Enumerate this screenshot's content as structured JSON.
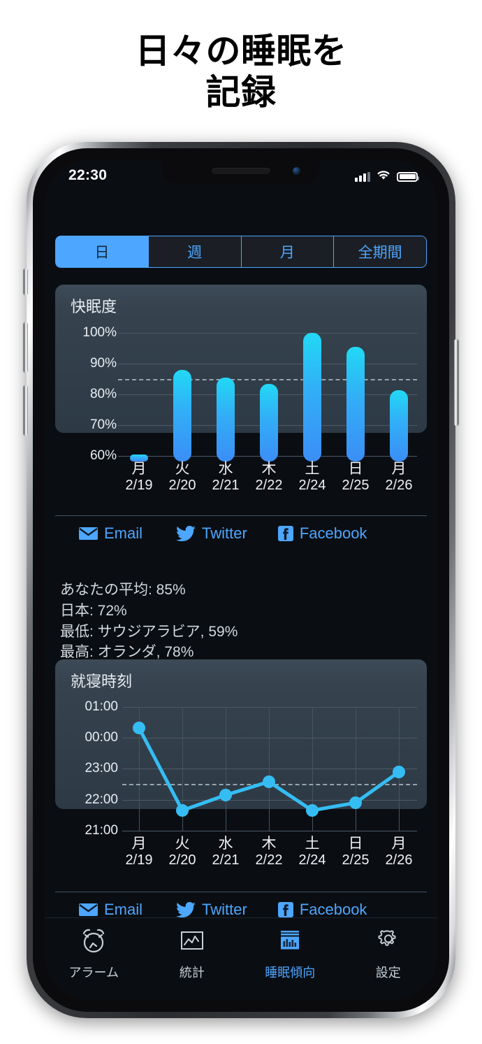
{
  "headline": "日々の睡眠を\n記録",
  "status_bar": {
    "time": "22:30",
    "cellular_icon": "cellular-bars-icon",
    "wifi_icon": "wifi-icon",
    "battery_icon": "battery-full-icon"
  },
  "segmented_control": {
    "selected": "日",
    "options": [
      "日",
      "週",
      "月",
      "全期間"
    ]
  },
  "sleep_quality_card": {
    "title": "快眠度",
    "share": [
      {
        "label": "Email",
        "icon": "email-icon"
      },
      {
        "label": "Twitter",
        "icon": "twitter-icon"
      },
      {
        "label": "Facebook",
        "icon": "facebook-icon"
      }
    ]
  },
  "bedtime_card": {
    "title": "就寝時刻",
    "share": [
      {
        "label": "Email",
        "icon": "email-icon"
      },
      {
        "label": "Twitter",
        "icon": "twitter-icon"
      },
      {
        "label": "Facebook",
        "icon": "facebook-icon"
      }
    ]
  },
  "stats": {
    "your_average": "あなたの平均: 85%",
    "country": "日本: 72%",
    "lowest": "最低: サウジアラビア, 59%",
    "highest": "最高: オランダ, 78%"
  },
  "tab_bar": {
    "active": "睡眠傾向",
    "items": [
      {
        "label": "アラーム",
        "icon": "alarm-clock-icon"
      },
      {
        "label": "統計",
        "icon": "line-chart-icon"
      },
      {
        "label": "睡眠傾向",
        "icon": "bar-chart-icon"
      },
      {
        "label": "設定",
        "icon": "gear-icon"
      }
    ]
  },
  "colors": {
    "accent": "#4da6ff",
    "bar_top": "#22d8f5",
    "bar_bottom": "#3b8ef6",
    "card_bg": "#36434f",
    "screen_bg": "#0a0e13",
    "dashed_avg": "#97a4b0"
  },
  "chart_data": [
    {
      "type": "bar",
      "title": "快眠度",
      "xlabel": "",
      "ylabel": "",
      "categories": [
        "月",
        "火",
        "水",
        "木",
        "土",
        "日",
        "月"
      ],
      "category_dates": [
        "2/19",
        "2/20",
        "2/21",
        "2/22",
        "2/24",
        "2/25",
        "2/26"
      ],
      "values": [
        60.5,
        88,
        85.5,
        83.5,
        100,
        95.5,
        81.5
      ],
      "unit": "%",
      "ylim": [
        60,
        100
      ],
      "yticks": [
        60,
        70,
        80,
        90,
        100
      ],
      "ytick_labels": [
        "60%",
        "70%",
        "80%",
        "90%",
        "100%"
      ],
      "grid": true,
      "legend": "none",
      "annotations": [
        {
          "type": "dashed-average-line",
          "value": 85,
          "label": "あなたの平均: 85%"
        }
      ]
    },
    {
      "type": "line",
      "title": "就寝時刻",
      "xlabel": "",
      "ylabel": "",
      "categories": [
        "月",
        "火",
        "水",
        "木",
        "土",
        "日",
        "月"
      ],
      "category_dates": [
        "2/19",
        "2/20",
        "2/21",
        "2/22",
        "2/24",
        "2/25",
        "2/26"
      ],
      "values": [
        "00:20",
        "21:40",
        "22:10",
        "22:35",
        "21:40",
        "21:55",
        "22:55"
      ],
      "values_numeric": [
        24.33,
        21.67,
        22.17,
        22.58,
        21.67,
        21.92,
        22.92
      ],
      "ylim": [
        "21:00",
        "01:00"
      ],
      "yticks": [
        "21:00",
        "22:00",
        "23:00",
        "00:00",
        "01:00"
      ],
      "ytick_labels": [
        "21:00",
        "22:00",
        "23:00",
        "00:00",
        "01:00"
      ],
      "grid": true,
      "legend": "none",
      "annotations": [
        {
          "type": "dashed-average-line",
          "value": "22:30"
        }
      ]
    }
  ]
}
